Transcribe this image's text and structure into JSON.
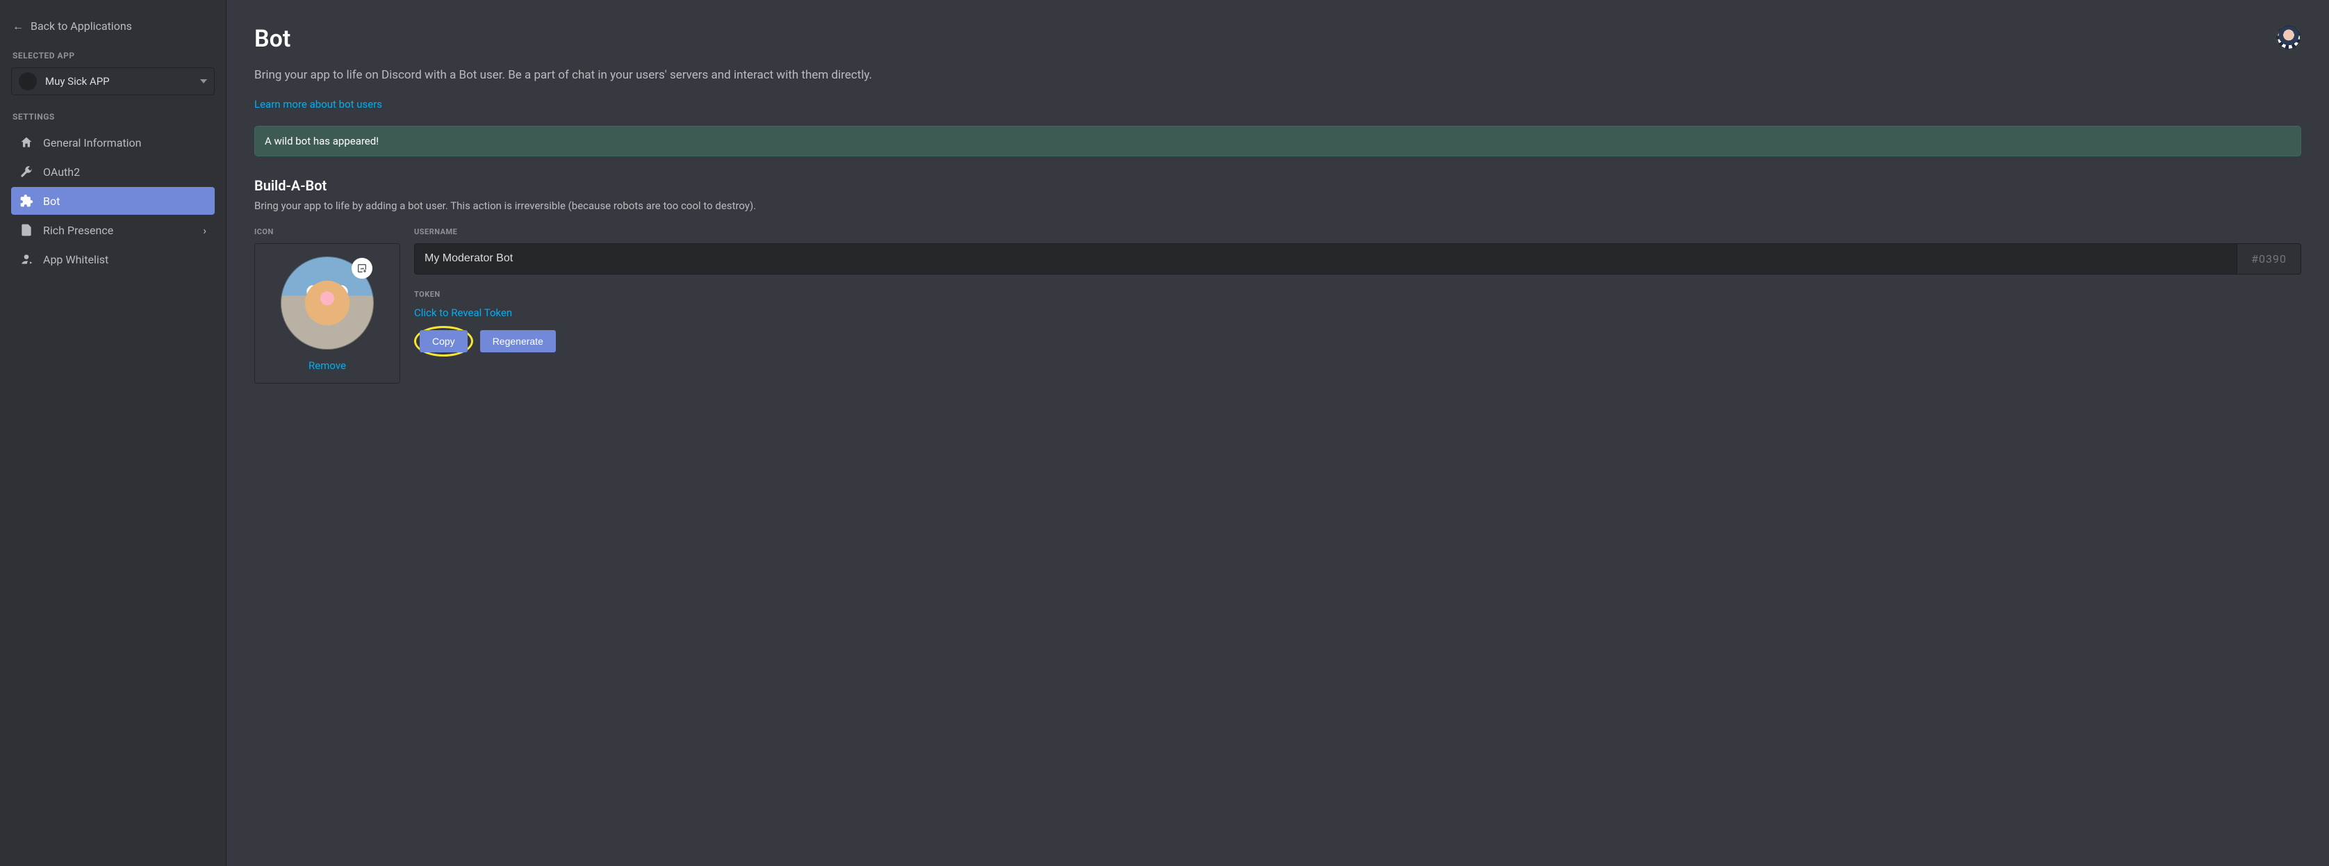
{
  "sidebar": {
    "back_label": "Back to Applications",
    "selected_app_header": "Selected App",
    "selected_app_name": "Muy Sick APP",
    "settings_header": "Settings",
    "items": [
      {
        "label": "General Information"
      },
      {
        "label": "OAuth2"
      },
      {
        "label": "Bot"
      },
      {
        "label": "Rich Presence"
      },
      {
        "label": "App Whitelist"
      }
    ]
  },
  "page": {
    "title": "Bot",
    "description": "Bring your app to life on Discord with a Bot user. Be a part of chat in your users' servers and interact with them directly.",
    "learn_more": "Learn more about bot users"
  },
  "alert": {
    "text": "A wild bot has appeared!"
  },
  "build": {
    "title": "Build-A-Bot",
    "description": "Bring your app to life by adding a bot user. This action is irreversible (because robots are too cool to destroy).",
    "icon_label": "Icon",
    "remove_label": "Remove",
    "username_label": "Username",
    "username_value": "My Moderator Bot",
    "discriminator": "#0390",
    "token_label": "Token",
    "reveal_label": "Click to Reveal Token",
    "copy_label": "Copy",
    "regenerate_label": "Regenerate"
  }
}
